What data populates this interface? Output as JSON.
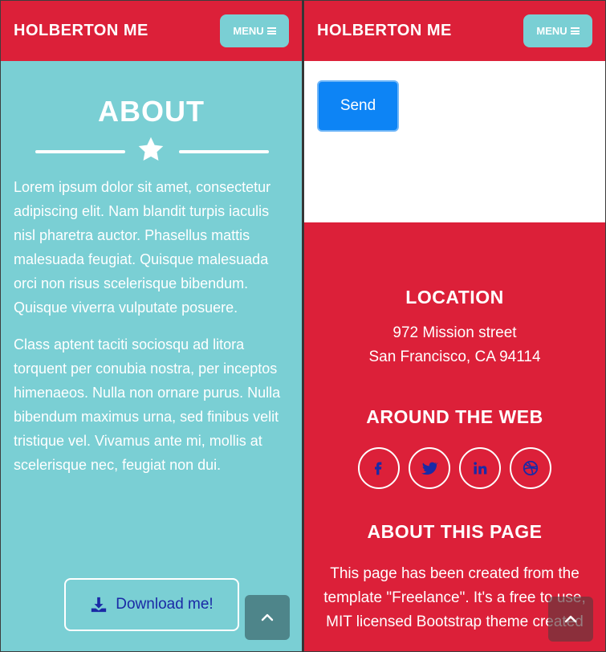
{
  "left": {
    "brand": "HOLBERTON ME",
    "menu_label": "MENU",
    "about": {
      "title": "ABOUT",
      "paragraphs": [
        "Lorem ipsum dolor sit amet, consectetur adipiscing elit. Nam blandit turpis iaculis nisl pharetra auctor. Phasellus mattis malesuada feugiat. Quisque malesuada orci non risus scelerisque bibendum. Quisque viverra vulputate posuere.",
        "Class aptent taciti sociosqu ad litora torquent per conubia nostra, per inceptos himenaeos. Nulla non ornare purus. Nulla bibendum maximus urna, sed finibus velit tristique vel. Vivamus ante mi, mollis at scelerisque nec, feugiat non dui."
      ],
      "download_label": "Download me!"
    }
  },
  "right": {
    "brand": "HOLBERTON ME",
    "menu_label": "MENU",
    "send_label": "Send",
    "footer": {
      "location_title": "LOCATION",
      "address_line1": "972 Mission street",
      "address_line2": "San Francisco, CA 94114",
      "web_title": "AROUND THE WEB",
      "social_icons": [
        "facebook-icon",
        "twitter-icon",
        "linkedin-icon",
        "dribbble-icon"
      ],
      "about_page_title": "ABOUT THIS PAGE",
      "about_page_text": "This page has been created from the template \"Freelance\". It's a free to use, MIT licensed Bootstrap theme created"
    }
  },
  "colors": {
    "primary_red": "#dc2039",
    "teal": "#7acfd4",
    "link_blue": "#1a2aa6",
    "send_blue": "#0d84f5"
  }
}
